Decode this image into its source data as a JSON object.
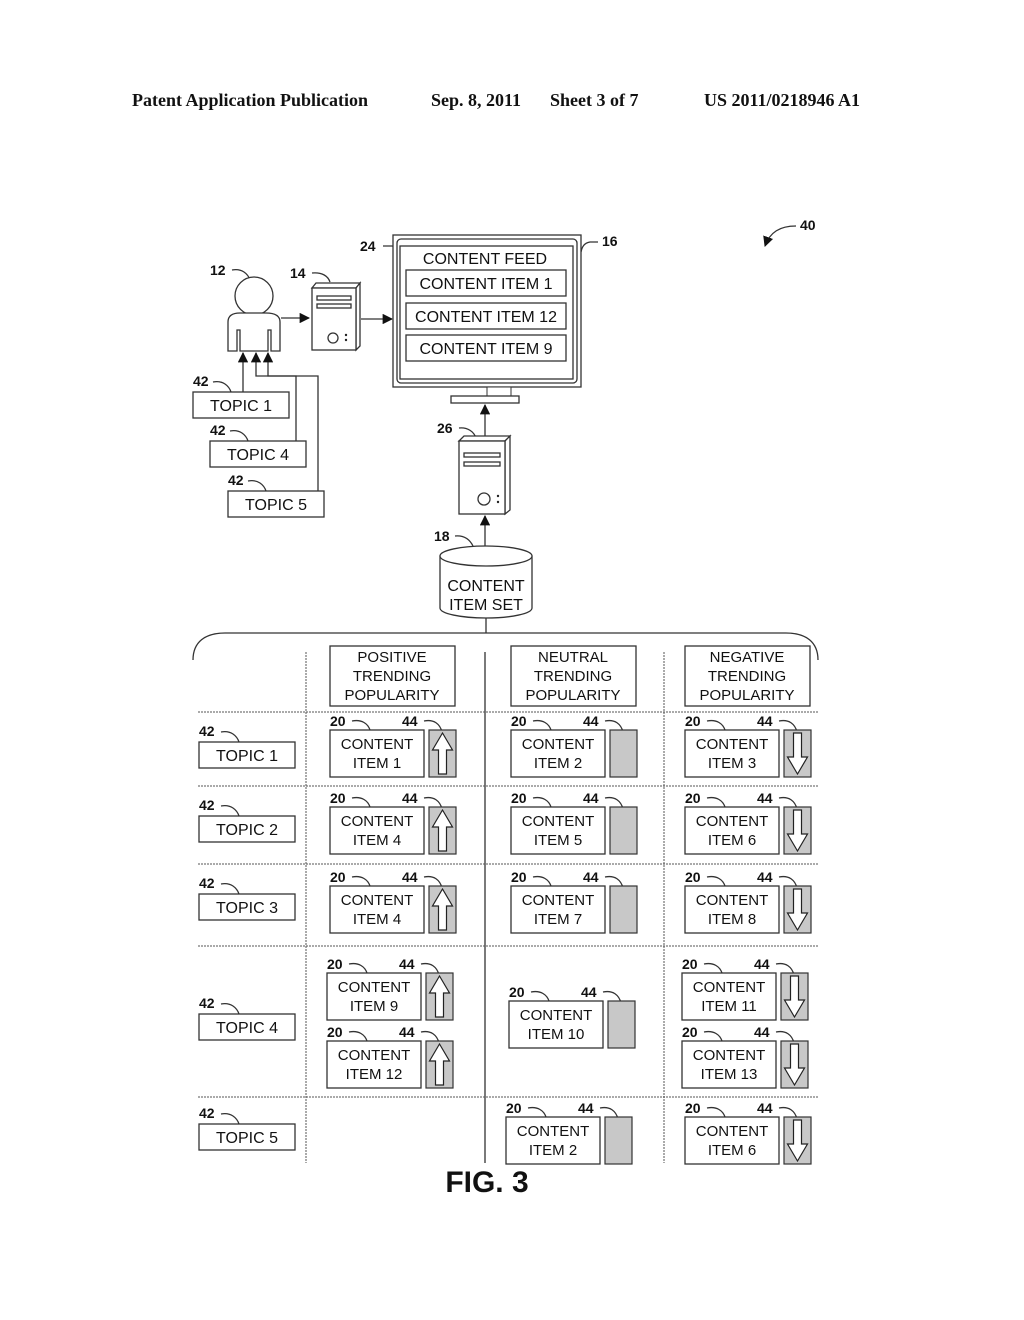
{
  "header": {
    "publication": "Patent Application Publication",
    "date": "Sep. 8, 2011",
    "sheet": "Sheet 3 of 7",
    "number": "US 2011/0218946 A1"
  },
  "figure": {
    "label": "FIG. 3",
    "ref_system": "40"
  },
  "top": {
    "user_ref": "12",
    "client_ref": "14",
    "display_ref": "16",
    "feed_ref": "24",
    "server_ref": "26",
    "store_ref": "18",
    "topic_ref": "42",
    "feed_title": "CONTENT FEED",
    "feed_items": [
      "CONTENT ITEM 1",
      "CONTENT ITEM 12",
      "CONTENT ITEM 9"
    ],
    "user_topics": [
      "TOPIC 1",
      "TOPIC 4",
      "TOPIC 5"
    ],
    "store_label_line1": "CONTENT",
    "store_label_line2": "ITEM SET"
  },
  "table": {
    "columns": [
      {
        "line1": "POSITIVE",
        "line2": "TRENDING",
        "line3": "POPULARITY",
        "trend": "up"
      },
      {
        "line1": "NEUTRAL",
        "line2": "TRENDING",
        "line3": "POPULARITY",
        "trend": "neutral"
      },
      {
        "line1": "NEGATIVE",
        "line2": "TRENDING",
        "line3": "POPULARITY",
        "trend": "down"
      }
    ],
    "item_ref": "20",
    "indicator_ref": "44",
    "topic_ref": "42",
    "content_word": "CONTENT",
    "rows": [
      {
        "topic": "TOPIC 1",
        "cells": [
          [
            "ITEM 1"
          ],
          [
            "ITEM 2"
          ],
          [
            "ITEM 3"
          ]
        ]
      },
      {
        "topic": "TOPIC 2",
        "cells": [
          [
            "ITEM 4"
          ],
          [
            "ITEM 5"
          ],
          [
            "ITEM 6"
          ]
        ]
      },
      {
        "topic": "TOPIC 3",
        "cells": [
          [
            "ITEM 4"
          ],
          [
            "ITEM 7"
          ],
          [
            "ITEM 8"
          ]
        ]
      },
      {
        "topic": "TOPIC 4",
        "cells": [
          [
            "ITEM 9",
            "ITEM 12"
          ],
          [
            "ITEM 10"
          ],
          [
            "ITEM 11",
            "ITEM 13"
          ]
        ]
      },
      {
        "topic": "TOPIC 5",
        "cells": [
          [],
          [
            "ITEM 2"
          ],
          [
            "ITEM 6"
          ]
        ]
      }
    ]
  }
}
